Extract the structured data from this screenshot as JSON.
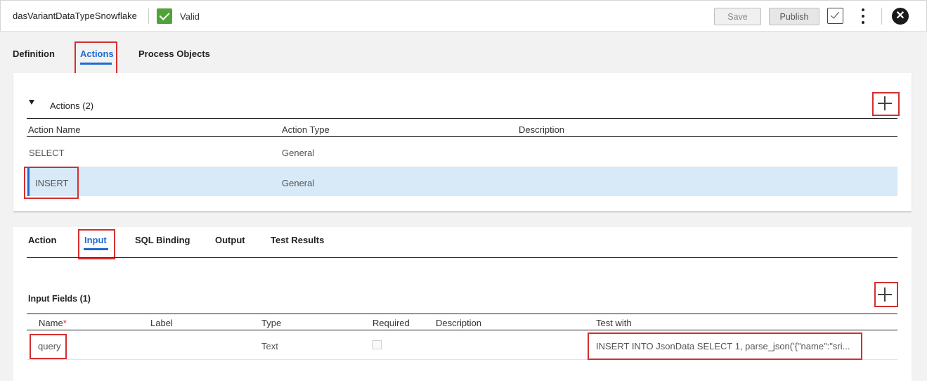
{
  "header": {
    "asset_name": "dasVariantDataTypeSnowflake",
    "status": "Valid",
    "save_label": "Save",
    "publish_label": "Publish",
    "close_glyph": "✕"
  },
  "top_tabs": [
    {
      "label": "Definition"
    },
    {
      "label": "Actions"
    },
    {
      "label": "Process Objects"
    }
  ],
  "actions_section": {
    "title": "Actions (2)",
    "columns": [
      "Action Name",
      "Action Type",
      "Description"
    ],
    "rows": [
      {
        "name": "SELECT",
        "type": "General",
        "description": ""
      },
      {
        "name": "INSERT",
        "type": "General",
        "description": ""
      }
    ]
  },
  "sub_tabs": [
    {
      "label": "Action"
    },
    {
      "label": "Input"
    },
    {
      "label": "SQL Binding"
    },
    {
      "label": "Output"
    },
    {
      "label": "Test Results"
    }
  ],
  "input_section": {
    "title": "Input Fields (1)",
    "columns": {
      "name": "Name",
      "required_marker": "*",
      "label": "Label",
      "type": "Type",
      "required": "Required",
      "description": "Description",
      "test_with": "Test with"
    },
    "rows": [
      {
        "name": "query",
        "label": "",
        "type": "Text",
        "required": false,
        "description": "",
        "test_with": "INSERT INTO JsonData SELECT 1, parse_json('{\"name\":\"sri..."
      }
    ]
  },
  "colors": {
    "accent": "#1f6bd1",
    "valid": "#51a339",
    "highlight_box": "#d32f2f",
    "selected_row": "#d8e9f8"
  },
  "icons": [
    "check-icon",
    "validate-icon",
    "kebab-menu-icon",
    "close-icon",
    "collapse-triangle-icon",
    "add-icon"
  ]
}
